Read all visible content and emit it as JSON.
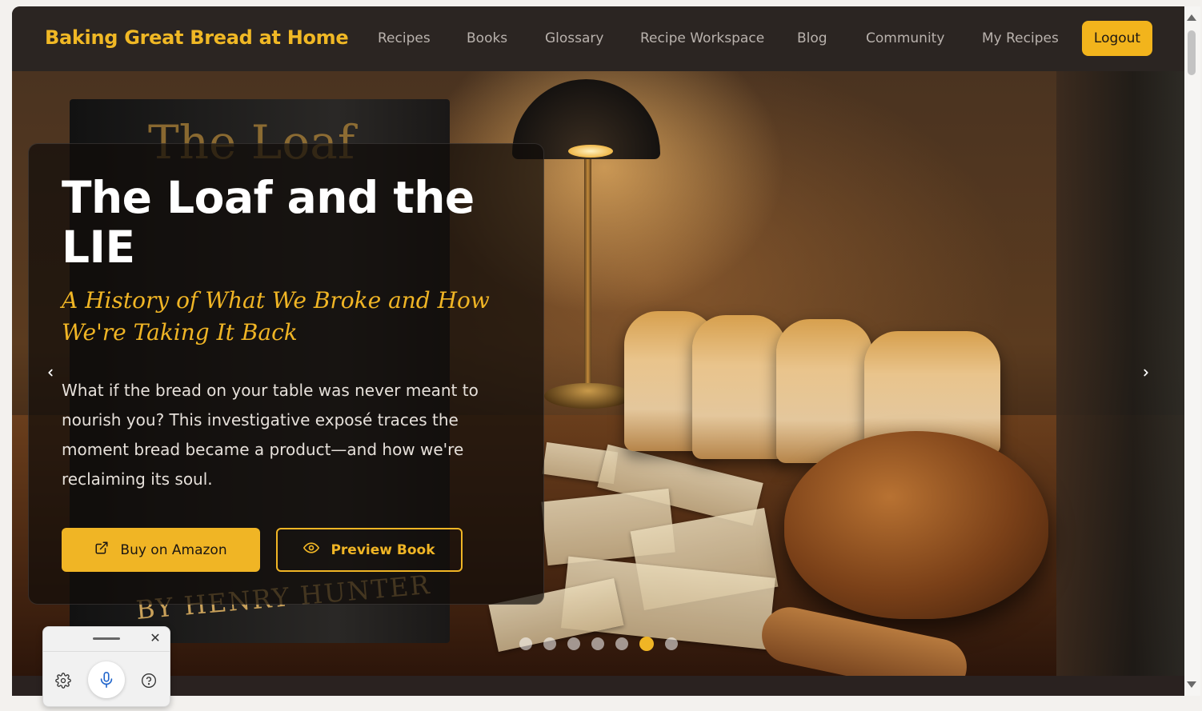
{
  "header": {
    "brand": "Baking Great Bread at Home",
    "nav": [
      {
        "label": "Recipes"
      },
      {
        "label": "Books"
      },
      {
        "label": "Glossary"
      },
      {
        "label": "Recipe Workspace"
      },
      {
        "label": "Blog"
      },
      {
        "label": "Community"
      },
      {
        "label": "My Recipes"
      }
    ],
    "logout_label": "Logout"
  },
  "hero": {
    "title": "The Loaf and the LIE",
    "subtitle": "A History of What We Broke and How We're Taking It Back",
    "description": "What if the bread on your table was never meant to nourish you? This investigative exposé traces the moment bread became a product—and how we're reclaiming its soul.",
    "buy_label": "Buy on Amazon",
    "preview_label": "Preview Book",
    "book_cover_title": "The Loaf",
    "book_cover_author": "BY HENRY HUNTER",
    "prev_icon": "chevron-left-icon",
    "next_icon": "chevron-right-icon",
    "slide_count": 7,
    "active_slide": 6
  },
  "colors": {
    "accent": "#f0b525",
    "nav_bg": "#2b2522",
    "nav_text": "#b9b2ad"
  },
  "voice_widget": {
    "icons": [
      "gear-icon",
      "microphone-icon",
      "help-icon",
      "close-icon"
    ]
  }
}
